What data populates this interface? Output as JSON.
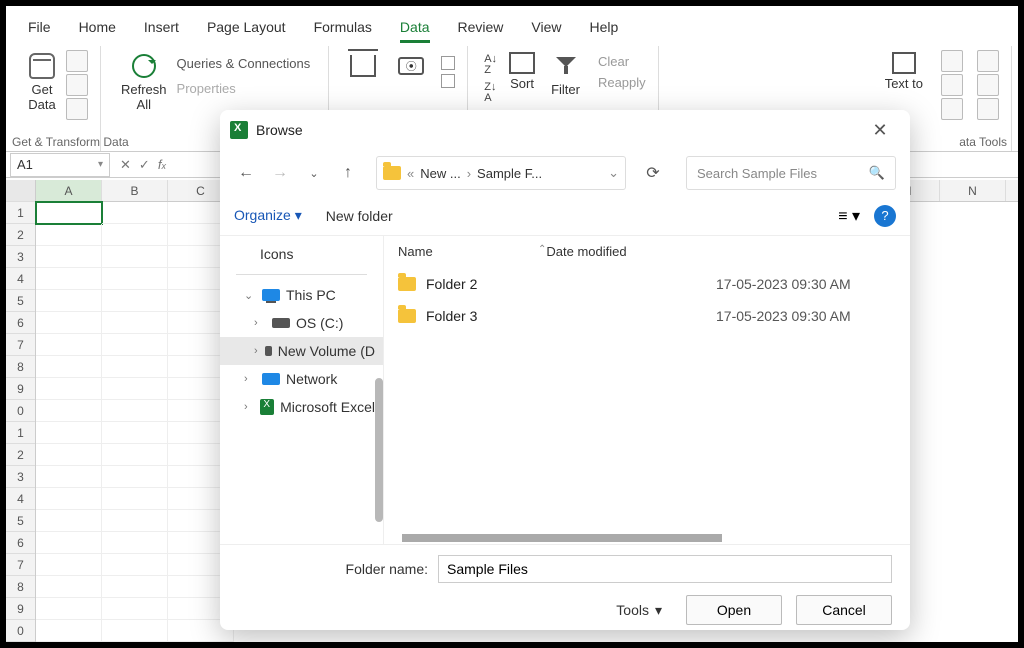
{
  "menu": {
    "items": [
      "File",
      "Home",
      "Insert",
      "Page Layout",
      "Formulas",
      "Data",
      "Review",
      "View",
      "Help"
    ],
    "active": "Data"
  },
  "ribbon": {
    "get_data": "Get\nData",
    "get_transform_label": "Get & Transform Data",
    "refresh_all": "Refresh\nAll",
    "queries_connections": "Queries & Connections",
    "properties": "Properties",
    "sort": "Sort",
    "filter": "Filter",
    "clear": "Clear",
    "reapply": "Reapply",
    "text_to": "Text to",
    "data_tools": "ata Tools"
  },
  "formula_bar": {
    "cell": "A1"
  },
  "columns": [
    "A",
    "B",
    "C",
    "M",
    "N"
  ],
  "rows": [
    "1",
    "2",
    "3",
    "4",
    "5",
    "6",
    "7",
    "8",
    "9",
    "0",
    "1",
    "2",
    "3",
    "4",
    "5",
    "6",
    "7",
    "8",
    "9",
    "0"
  ],
  "dialog": {
    "title": "Browse",
    "crumb1": "New ...",
    "crumb2": "Sample F...",
    "search_placeholder": "Search Sample Files",
    "organize": "Organize",
    "new_folder": "New folder",
    "headers": {
      "name": "Name",
      "date": "Date modified"
    },
    "tree": {
      "icons": "Icons",
      "this_pc": "This PC",
      "os": "OS (C:)",
      "new_vol": "New Volume (D",
      "network": "Network",
      "excel": "Microsoft Excel"
    },
    "files": [
      {
        "name": "Folder 2",
        "date": "17-05-2023 09:30 AM"
      },
      {
        "name": "Folder 3",
        "date": "17-05-2023 09:30 AM"
      }
    ],
    "folder_name_label": "Folder name:",
    "folder_name_value": "Sample Files",
    "tools": "Tools",
    "open": "Open",
    "cancel": "Cancel"
  }
}
